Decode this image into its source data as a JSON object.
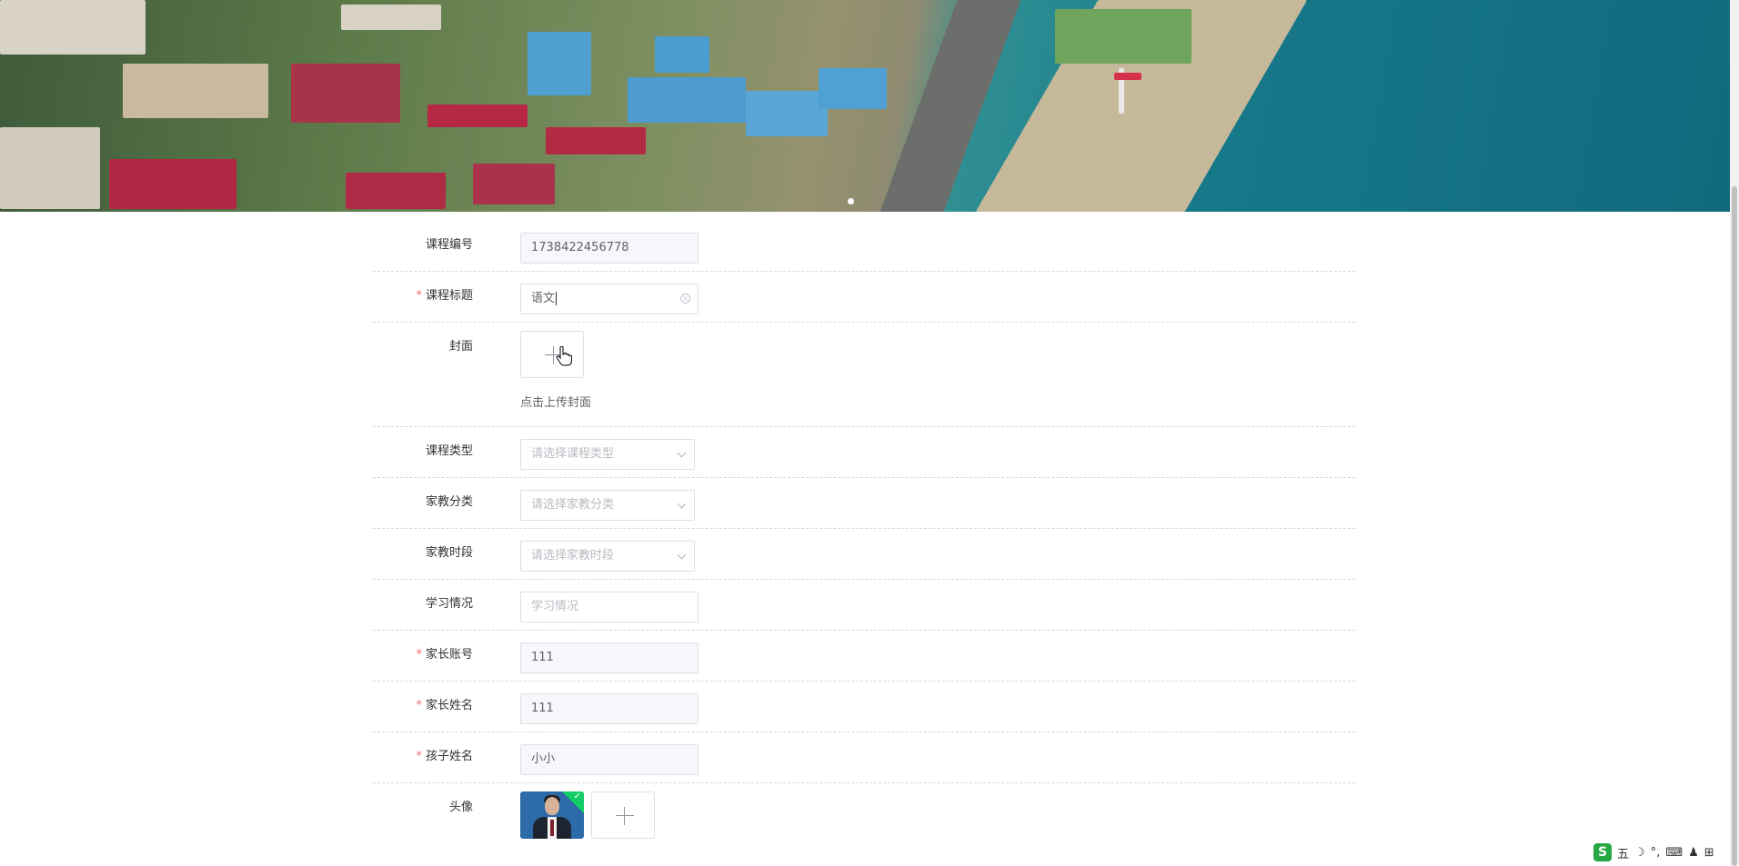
{
  "colors": {
    "required": "#f56c6c",
    "border": "#dcdfe6",
    "disabled_bg": "#f5f7fa",
    "upload_success": "#13ce66"
  },
  "form": {
    "course_id": {
      "label": "课程编号",
      "value": "1738422456778"
    },
    "course_title": {
      "label": "课程标题",
      "required_mark": "*",
      "value": "语文"
    },
    "cover": {
      "label": "封面",
      "hint": "点击上传封面"
    },
    "course_type": {
      "label": "课程类型",
      "placeholder": "请选择课程类型"
    },
    "tutor_category": {
      "label": "家教分类",
      "placeholder": "请选择家教分类"
    },
    "tutor_period": {
      "label": "家教时段",
      "placeholder": "请选择家教时段"
    },
    "study_status": {
      "label": "学习情况",
      "placeholder": "学习情况"
    },
    "parent_account": {
      "label": "家长账号",
      "required_mark": "*",
      "value": "111"
    },
    "parent_name": {
      "label": "家长姓名",
      "required_mark": "*",
      "value": "111"
    },
    "child_name": {
      "label": "孩子姓名",
      "required_mark": "*",
      "value": "小小"
    },
    "avatar": {
      "label": "头像"
    }
  },
  "tray": {
    "ime_logo": "S",
    "ime_mode": "五",
    "icons": [
      "moon-icon",
      "punctuation-icon",
      "keyboard-icon",
      "user-icon",
      "grid-icon"
    ]
  }
}
